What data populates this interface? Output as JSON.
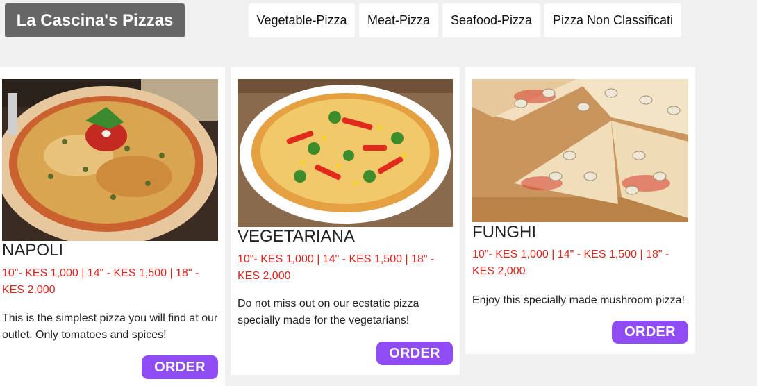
{
  "header": {
    "brand": "La Cascina's Pizzas",
    "nav": [
      "Vegetable-Pizza",
      "Meat-Pizza",
      "Seafood-Pizza",
      "Pizza Non Classificati"
    ]
  },
  "menu": [
    {
      "name": "NAPOLI",
      "price": "10\"- KES 1,000 | 14\" - KES 1,500 | 18\" - KES 2,000",
      "description": "This is the simplest pizza you will find at our outlet. Only tomatoes and spices!",
      "button": "ORDER"
    },
    {
      "name": "VEGETARIANA",
      "price": "10\"- KES 1,000 | 14\" - KES 1,500 | 18\" - KES 2,000",
      "description": "Do not miss out on our ecstatic pizza specially made for the vegetarians!",
      "button": "ORDER"
    },
    {
      "name": "FUNGHI",
      "price": "10\"- KES 1,000 | 14\" - KES 1,500 | 18\" - KES 2,000",
      "description": "Enjoy this specially made mushroom pizza!",
      "button": "ORDER"
    }
  ],
  "colors": {
    "background": "#f0f0f0",
    "brand_bg": "#666666",
    "price": "#e0231b",
    "button": "#8f4cf5"
  }
}
